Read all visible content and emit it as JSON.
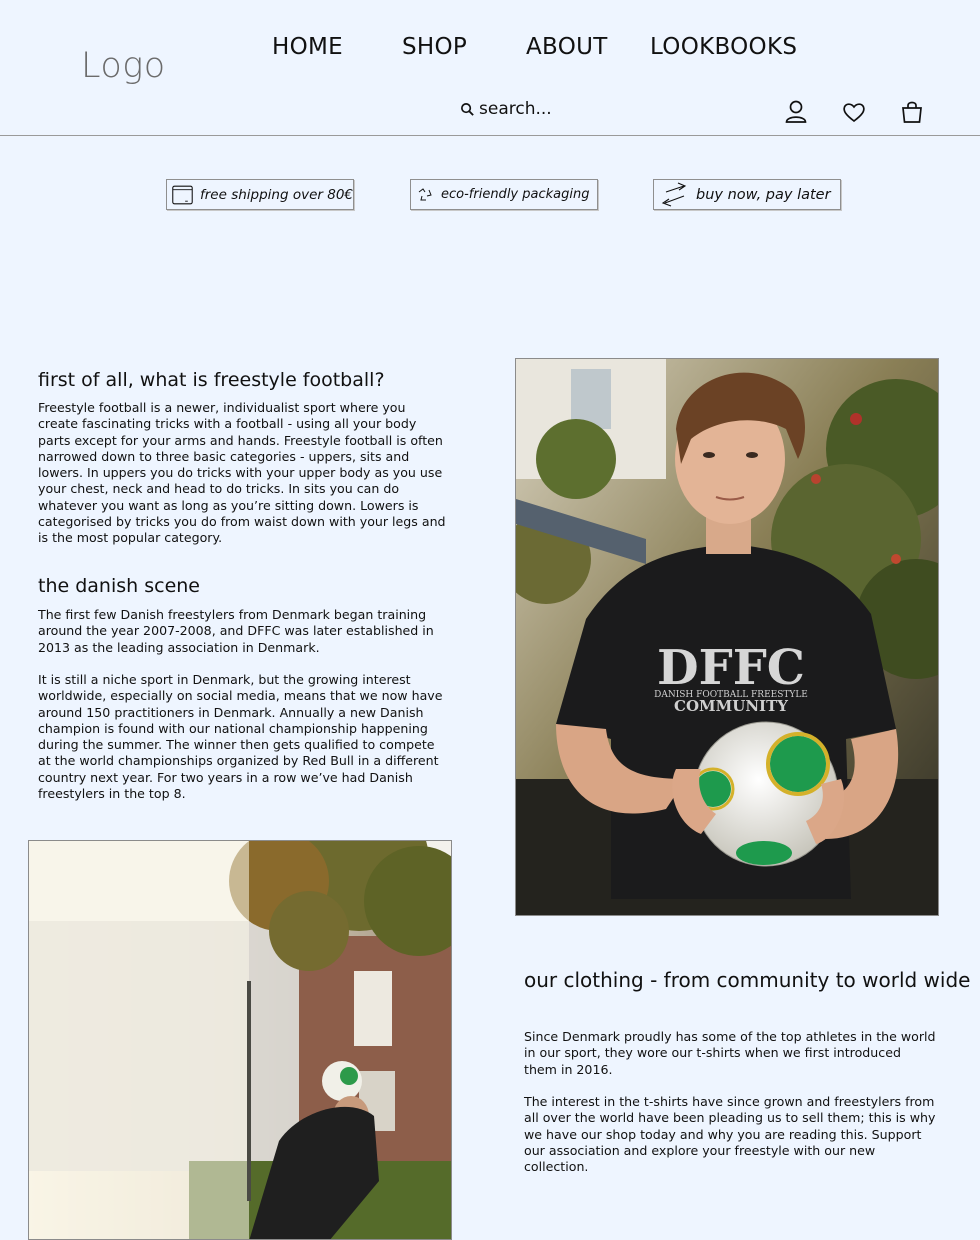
{
  "header": {
    "logo": "Logo",
    "nav": [
      "HOME",
      "SHOP",
      "ABOUT",
      "LOOKBOOKS"
    ],
    "search_placeholder": "search..."
  },
  "badges": [
    {
      "label": "free shipping over 80€",
      "icon": "package-icon"
    },
    {
      "label": "eco-friendly packaging",
      "icon": "recycle-icon"
    },
    {
      "label": "buy now, pay later",
      "icon": "exchange-arrows-icon"
    }
  ],
  "section1": {
    "title": "first of  all, what is freestyle football?",
    "body": "Freestyle football is a newer, individualist sport where you create fascinating tricks with a football - using all your body parts except for your arms and hands. Freestyle football is often narrowed down to three basic categories - uppers, sits and lowers. In uppers you do tricks with your upper body as you use your chest, neck and head to do tricks. In sits you can do whatever you want as long as you’re sitting down. Lowers is categorised by tricks you do from waist down with your legs and is the most popular category."
  },
  "section2": {
    "title": "the danish scene",
    "p1": "The first few Danish freestylers from Denmark began training around the year 2007-2008, and DFFC was later established in 2013 as the leading association in Denmark.",
    "p2": "It is still a niche sport in Denmark, but the growing interest worldwide, especially on social media, means that we now have around 150 practitioners in Denmark. Annually a new Danish champion is found with our national championship happening during the summer. The winner then gets qualified to compete at the world championships organized by Red Bull in a different country next year. For two years in a row we’ve had Danish freestylers in the top 8."
  },
  "section3": {
    "title": "our clothing - from community to world wide",
    "p1": "Since Denmark proudly has some of the top athletes in the world in our sport, they wore our t-shirts when we first introduced them in 2016.",
    "p2": "The interest in the t-shirts have since grown and freestylers from all over the world have been pleading us to sell them; this is why we have our shop today and why you are reading this. Support our association and explore your freestyle with our new collection."
  },
  "photo_tshirt": {
    "line1": "DFFC",
    "line2": "DANISH FOOTBALL FREESTYLE",
    "line3": "COMMUNITY"
  }
}
